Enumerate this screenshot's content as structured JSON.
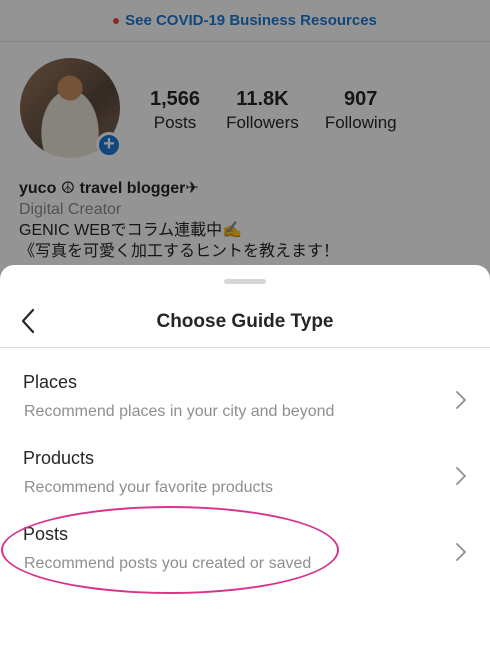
{
  "banner": {
    "text": "See COVID-19 Business Resources"
  },
  "profile": {
    "stats": [
      {
        "value": "1,566",
        "label": "Posts"
      },
      {
        "value": "11.8K",
        "label": "Followers"
      },
      {
        "value": "907",
        "label": "Following"
      }
    ],
    "name": "yuco ☮ travel blogger✈︎",
    "category": "Digital Creator",
    "bio_line1": "GENIC WEBでコラム連載中✍️",
    "bio_line2": "《写真を可愛く加工するヒントを教えます！"
  },
  "sheet": {
    "title": "Choose Guide Type",
    "options": [
      {
        "title": "Places",
        "description": "Recommend places in your city and beyond"
      },
      {
        "title": "Products",
        "description": "Recommend your favorite products"
      },
      {
        "title": "Posts",
        "description": "Recommend posts you created or saved"
      }
    ]
  },
  "colors": {
    "accent": "#1d7bd8",
    "highlight": "#d8338a",
    "overlay": "rgba(0,0,0,0.42)"
  },
  "icons": {
    "back": "chevron-left-icon",
    "row_chevron": "chevron-right-icon",
    "avatar_add": "plus-icon"
  }
}
